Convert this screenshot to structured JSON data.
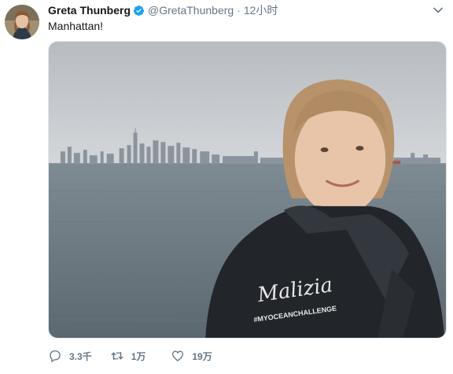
{
  "author": {
    "name": "Greta Thunberg",
    "handle": "@GretaThunberg",
    "verified": true
  },
  "timestamp": "12小时",
  "separator": "·",
  "text": "Manhattan!",
  "actions": {
    "replies": "3.3千",
    "retweets": "1万",
    "likes": "19万"
  },
  "media": {
    "jacket_brand": "Malizia",
    "jacket_tag": "#MYOCEANCHALLENGE"
  },
  "colors": {
    "verified": "#1da1f2",
    "icon": "#657786",
    "text": "#14171a"
  }
}
